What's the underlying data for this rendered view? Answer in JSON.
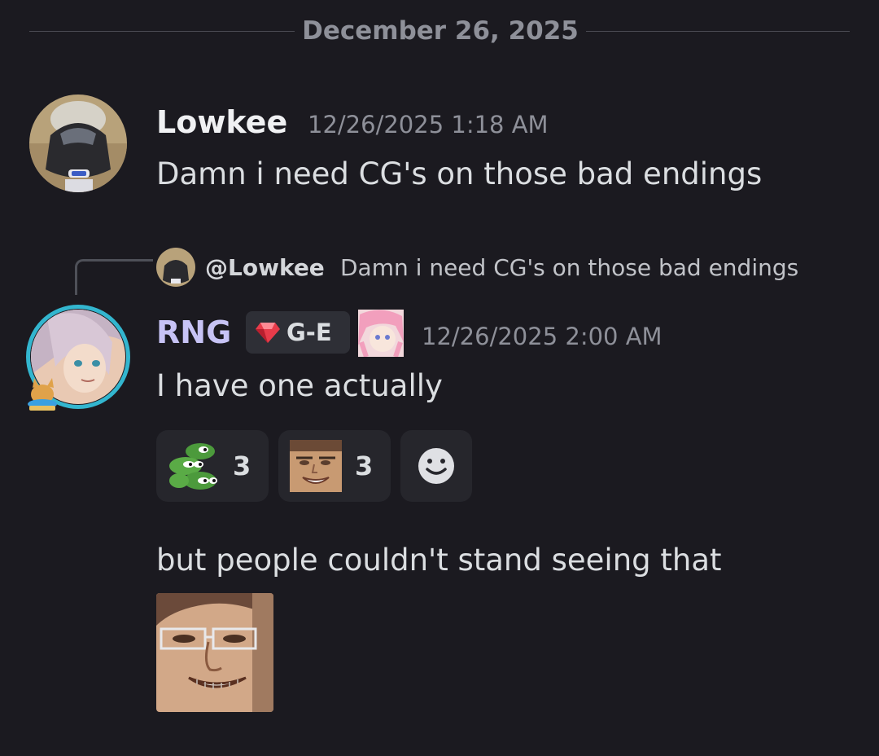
{
  "divider": {
    "date": "December 26, 2025"
  },
  "messages": [
    {
      "author": "Lowkee",
      "timestamp": "12/26/2025 1:18 AM",
      "text": "Damn i need CG's on those bad endings"
    },
    {
      "author": "RNG",
      "author_color": "#c7c3f5",
      "server_tag": "G-E",
      "timestamp": "12/26/2025 2:00 AM",
      "reply": {
        "mention": "@Lowkee",
        "text": "Damn i need CG's on those bad endings"
      },
      "text": "I have one actually",
      "reactions": [
        {
          "emoji": "frogs-emoji",
          "count": "3"
        },
        {
          "emoji": "grinning-face-emoji",
          "count": "3"
        },
        {
          "emoji": "add-reaction-icon"
        }
      ],
      "followup_text": "but people couldn't stand seeing that",
      "sticker": "grinning-man-sticker"
    }
  ],
  "colors": {
    "background": "#1b1a20",
    "avatar_ring": "#33b6cf",
    "reaction_bg": "#26262c"
  }
}
